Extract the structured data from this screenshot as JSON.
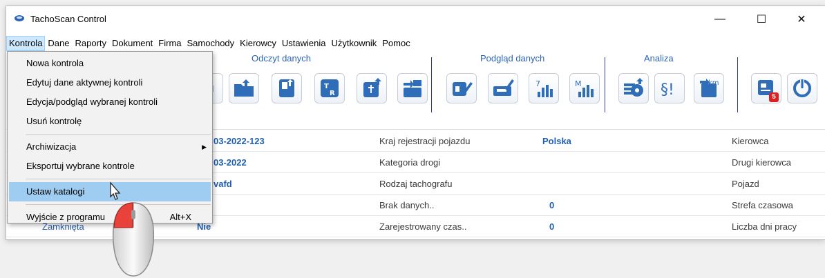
{
  "window": {
    "title": "TachoScan Control"
  },
  "window_controls": {
    "minimize": "—",
    "maximize": "☐",
    "close": "✕"
  },
  "menu": [
    "Kontrola",
    "Dane",
    "Raporty",
    "Dokument",
    "Firma",
    "Samochody",
    "Kierowcy",
    "Ustawienia",
    "Użytkownik",
    "Pomoc"
  ],
  "ribbon": {
    "groups": [
      "Odczyt danych",
      "Podgląd danych",
      "Analiza"
    ],
    "badge": "5",
    "icons": {
      "r1": "download-card-icon",
      "r2": "open-folder-icon",
      "r3": "card-reader-icon",
      "r4": "tachograph-r-icon",
      "r5": "usb-download-icon",
      "r6": "device-transfer-icon",
      "p1": "card-view-icon",
      "p2": "vehicle-view-icon",
      "p3": "weekly-chart-icon",
      "p4": "monthly-chart-icon",
      "a1": "data-analysis-icon",
      "a2": "infringements-icon",
      "a3": "distance-km-icon",
      "n1": "news-icon",
      "n2": "power-icon"
    }
  },
  "dropdown": {
    "items": [
      {
        "label": "Nowa kontrola"
      },
      {
        "label": "Edytuj dane aktywnej kontroli"
      },
      {
        "label": "Edycja/podgląd wybranej kontroli"
      },
      {
        "label": "Usuń kontrolę"
      },
      {
        "label": "Archiwizacja",
        "submenu_arrow": "▶"
      },
      {
        "label": "Eksportuj wybrane kontrole"
      },
      {
        "label": "Ustaw katalogi"
      },
      {
        "label": "Wyjście z programu",
        "shortcut": "Alt+X"
      }
    ]
  },
  "grid": {
    "rows": [
      {
        "c1_val": "03-2022-123",
        "c2_lbl": "Kraj rejestracji pojazdu",
        "c2_val": "Polska",
        "c3_lbl": "Kierowca"
      },
      {
        "c1_val": "03-2022",
        "c2_lbl": "Kategoria drogi",
        "c2_val": "",
        "c3_lbl": "Drugi kierowca"
      },
      {
        "c1_val": "vafd",
        "c2_lbl": "Rodzaj tachografu",
        "c2_val": "",
        "c3_lbl": "Pojazd"
      },
      {
        "c1_val": "",
        "c2_lbl": "Brak danych..",
        "c2_val": "0",
        "c3_lbl": "Strefa czasowa"
      },
      {
        "c1_lbl": "Zamknięta",
        "c1_val": "Nie",
        "c2_lbl": "Zarejestrowany czas..",
        "c2_val": "0",
        "c3_lbl": "Liczba dni pracy"
      }
    ]
  },
  "colors": {
    "accent": "#2b64b7",
    "selection": "#9fcdf2",
    "value": "#1f5fb0",
    "badge": "#e02020"
  }
}
